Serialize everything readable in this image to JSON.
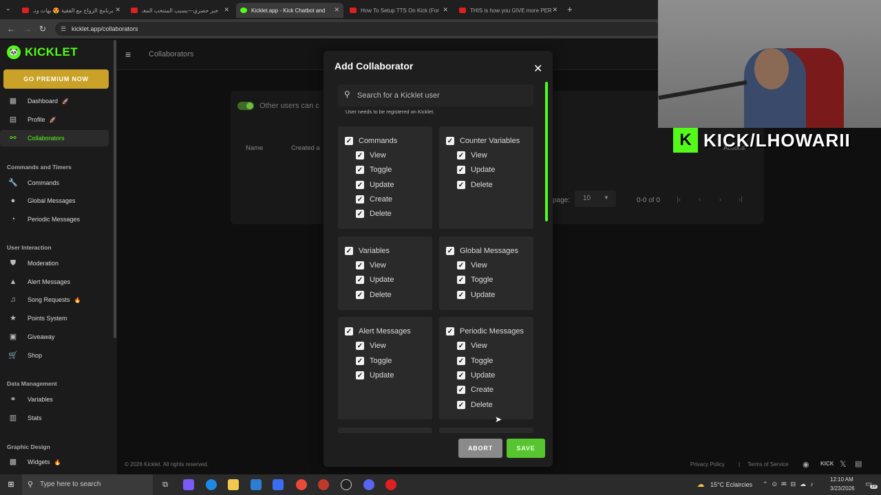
{
  "browser": {
    "tabs": [
      {
        "title": "برنامج الزواج مع الفقية 😍 بهات ونـ",
        "active": false
      },
      {
        "title": "خبر حصري—بسبب المنتخب المغـ",
        "active": false
      },
      {
        "title": "Kicklet.app - Kick Chatbot and",
        "active": true
      },
      {
        "title": "How To Setup TTS On Kick (For",
        "active": false
      },
      {
        "title": "THIS is how you GIVE more PER",
        "active": false
      }
    ],
    "new_tab": "+",
    "url": "kicklet.app/collaborators"
  },
  "sidebar": {
    "logo": "KICKLET",
    "premium_button": "GO PREMIUM NOW",
    "top_items": [
      {
        "label": "Dashboard",
        "icon": "dashboard-icon",
        "badge": "🚀"
      },
      {
        "label": "Profile",
        "icon": "profile-icon",
        "badge": "🚀"
      },
      {
        "label": "Collaborators",
        "icon": "collaborators-icon",
        "active": true
      }
    ],
    "sections": [
      {
        "title": "Commands and Timers",
        "items": [
          {
            "label": "Commands",
            "icon": "wrench-icon"
          },
          {
            "label": "Global Messages",
            "icon": "chat-bubble-icon"
          },
          {
            "label": "Periodic Messages",
            "icon": "clock-icon"
          }
        ]
      },
      {
        "title": "User Interaction",
        "items": [
          {
            "label": "Moderation",
            "icon": "shield-icon"
          },
          {
            "label": "Alert Messages",
            "icon": "warning-icon"
          },
          {
            "label": "Song Requests",
            "icon": "music-note-icon",
            "badge": "🔥"
          },
          {
            "label": "Points System",
            "icon": "star-icon"
          },
          {
            "label": "Giveaway",
            "icon": "gift-icon"
          },
          {
            "label": "Shop",
            "icon": "cart-icon"
          }
        ]
      },
      {
        "title": "Data Management",
        "items": [
          {
            "label": "Variables",
            "icon": "variables-icon"
          },
          {
            "label": "Stats",
            "icon": "bar-chart-icon"
          }
        ]
      },
      {
        "title": "Graphic Design",
        "items": [
          {
            "label": "Widgets",
            "icon": "widgets-icon",
            "badge": "🔥"
          }
        ]
      }
    ]
  },
  "main": {
    "page_title": "Collaborators",
    "toggle_label": "Other users can c",
    "columns": [
      "Name",
      "Created a",
      "Actions"
    ],
    "rows_per_page_label": "page:",
    "rows_per_page_value": "10",
    "pagination_range": "0-0 of 0",
    "footer_copyright": "© 2026 Kicklet. All rights reserved.",
    "footer_links": [
      "Privacy Policy",
      "|",
      "Terms of Service"
    ]
  },
  "modal": {
    "title": "Add Collaborator",
    "search_placeholder": "Search for a Kicklet user",
    "hint": "User needs to be registered on Kicklet.",
    "groups": [
      {
        "name": "Commands",
        "perms": [
          "View",
          "Toggle",
          "Update",
          "Create",
          "Delete"
        ]
      },
      {
        "name": "Counter Variables",
        "perms": [
          "View",
          "Update",
          "Delete"
        ]
      },
      {
        "name": "Variables",
        "perms": [
          "View",
          "Update",
          "Delete"
        ]
      },
      {
        "name": "Global Messages",
        "perms": [
          "View",
          "Toggle",
          "Update"
        ]
      },
      {
        "name": "Alert Messages",
        "perms": [
          "View",
          "Toggle",
          "Update"
        ]
      },
      {
        "name": "Periodic Messages",
        "perms": [
          "View",
          "Toggle",
          "Update",
          "Create",
          "Delete"
        ]
      }
    ],
    "abort_label": "ABORT",
    "save_label": "SAVE"
  },
  "overlay": {
    "kick_handle": "KICK/LHOWARII"
  },
  "taskbar": {
    "search_placeholder": "Type here to search",
    "weather": "15°C Eclaircies",
    "time": "12:10 AM",
    "date": "3/23/2026",
    "notification_count": "19"
  },
  "colors": {
    "accent": "#53fc18",
    "premium": "#c9a227",
    "save": "#57c52f",
    "abort": "#8a8a8a"
  }
}
